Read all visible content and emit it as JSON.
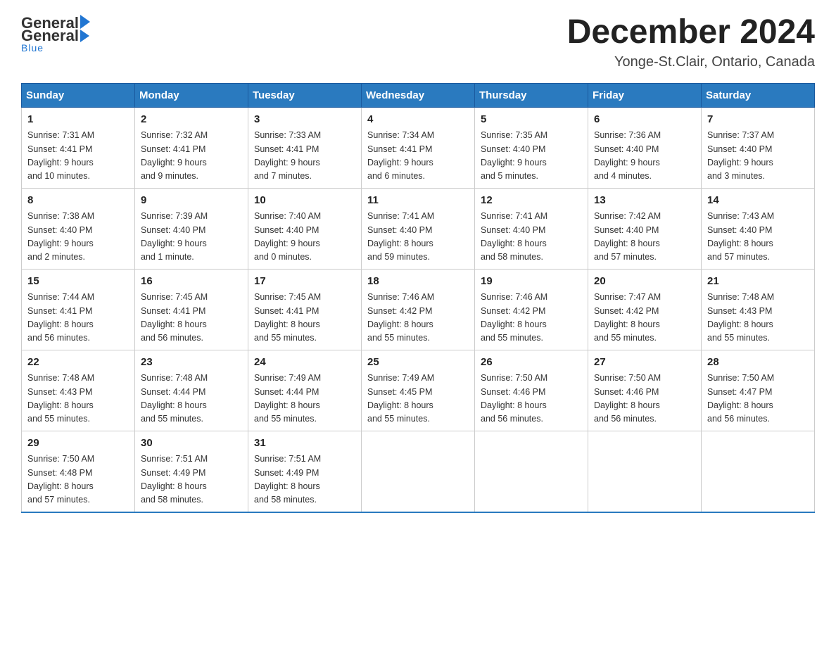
{
  "logo": {
    "general": "General",
    "arrow": "",
    "blue": "Blue"
  },
  "title": "December 2024",
  "location": "Yonge-St.Clair, Ontario, Canada",
  "days_of_week": [
    "Sunday",
    "Monday",
    "Tuesday",
    "Wednesday",
    "Thursday",
    "Friday",
    "Saturday"
  ],
  "weeks": [
    [
      {
        "day": "1",
        "info": "Sunrise: 7:31 AM\nSunset: 4:41 PM\nDaylight: 9 hours\nand 10 minutes."
      },
      {
        "day": "2",
        "info": "Sunrise: 7:32 AM\nSunset: 4:41 PM\nDaylight: 9 hours\nand 9 minutes."
      },
      {
        "day": "3",
        "info": "Sunrise: 7:33 AM\nSunset: 4:41 PM\nDaylight: 9 hours\nand 7 minutes."
      },
      {
        "day": "4",
        "info": "Sunrise: 7:34 AM\nSunset: 4:41 PM\nDaylight: 9 hours\nand 6 minutes."
      },
      {
        "day": "5",
        "info": "Sunrise: 7:35 AM\nSunset: 4:40 PM\nDaylight: 9 hours\nand 5 minutes."
      },
      {
        "day": "6",
        "info": "Sunrise: 7:36 AM\nSunset: 4:40 PM\nDaylight: 9 hours\nand 4 minutes."
      },
      {
        "day": "7",
        "info": "Sunrise: 7:37 AM\nSunset: 4:40 PM\nDaylight: 9 hours\nand 3 minutes."
      }
    ],
    [
      {
        "day": "8",
        "info": "Sunrise: 7:38 AM\nSunset: 4:40 PM\nDaylight: 9 hours\nand 2 minutes."
      },
      {
        "day": "9",
        "info": "Sunrise: 7:39 AM\nSunset: 4:40 PM\nDaylight: 9 hours\nand 1 minute."
      },
      {
        "day": "10",
        "info": "Sunrise: 7:40 AM\nSunset: 4:40 PM\nDaylight: 9 hours\nand 0 minutes."
      },
      {
        "day": "11",
        "info": "Sunrise: 7:41 AM\nSunset: 4:40 PM\nDaylight: 8 hours\nand 59 minutes."
      },
      {
        "day": "12",
        "info": "Sunrise: 7:41 AM\nSunset: 4:40 PM\nDaylight: 8 hours\nand 58 minutes."
      },
      {
        "day": "13",
        "info": "Sunrise: 7:42 AM\nSunset: 4:40 PM\nDaylight: 8 hours\nand 57 minutes."
      },
      {
        "day": "14",
        "info": "Sunrise: 7:43 AM\nSunset: 4:40 PM\nDaylight: 8 hours\nand 57 minutes."
      }
    ],
    [
      {
        "day": "15",
        "info": "Sunrise: 7:44 AM\nSunset: 4:41 PM\nDaylight: 8 hours\nand 56 minutes."
      },
      {
        "day": "16",
        "info": "Sunrise: 7:45 AM\nSunset: 4:41 PM\nDaylight: 8 hours\nand 56 minutes."
      },
      {
        "day": "17",
        "info": "Sunrise: 7:45 AM\nSunset: 4:41 PM\nDaylight: 8 hours\nand 55 minutes."
      },
      {
        "day": "18",
        "info": "Sunrise: 7:46 AM\nSunset: 4:42 PM\nDaylight: 8 hours\nand 55 minutes."
      },
      {
        "day": "19",
        "info": "Sunrise: 7:46 AM\nSunset: 4:42 PM\nDaylight: 8 hours\nand 55 minutes."
      },
      {
        "day": "20",
        "info": "Sunrise: 7:47 AM\nSunset: 4:42 PM\nDaylight: 8 hours\nand 55 minutes."
      },
      {
        "day": "21",
        "info": "Sunrise: 7:48 AM\nSunset: 4:43 PM\nDaylight: 8 hours\nand 55 minutes."
      }
    ],
    [
      {
        "day": "22",
        "info": "Sunrise: 7:48 AM\nSunset: 4:43 PM\nDaylight: 8 hours\nand 55 minutes."
      },
      {
        "day": "23",
        "info": "Sunrise: 7:48 AM\nSunset: 4:44 PM\nDaylight: 8 hours\nand 55 minutes."
      },
      {
        "day": "24",
        "info": "Sunrise: 7:49 AM\nSunset: 4:44 PM\nDaylight: 8 hours\nand 55 minutes."
      },
      {
        "day": "25",
        "info": "Sunrise: 7:49 AM\nSunset: 4:45 PM\nDaylight: 8 hours\nand 55 minutes."
      },
      {
        "day": "26",
        "info": "Sunrise: 7:50 AM\nSunset: 4:46 PM\nDaylight: 8 hours\nand 56 minutes."
      },
      {
        "day": "27",
        "info": "Sunrise: 7:50 AM\nSunset: 4:46 PM\nDaylight: 8 hours\nand 56 minutes."
      },
      {
        "day": "28",
        "info": "Sunrise: 7:50 AM\nSunset: 4:47 PM\nDaylight: 8 hours\nand 56 minutes."
      }
    ],
    [
      {
        "day": "29",
        "info": "Sunrise: 7:50 AM\nSunset: 4:48 PM\nDaylight: 8 hours\nand 57 minutes."
      },
      {
        "day": "30",
        "info": "Sunrise: 7:51 AM\nSunset: 4:49 PM\nDaylight: 8 hours\nand 58 minutes."
      },
      {
        "day": "31",
        "info": "Sunrise: 7:51 AM\nSunset: 4:49 PM\nDaylight: 8 hours\nand 58 minutes."
      },
      {
        "day": "",
        "info": ""
      },
      {
        "day": "",
        "info": ""
      },
      {
        "day": "",
        "info": ""
      },
      {
        "day": "",
        "info": ""
      }
    ]
  ]
}
